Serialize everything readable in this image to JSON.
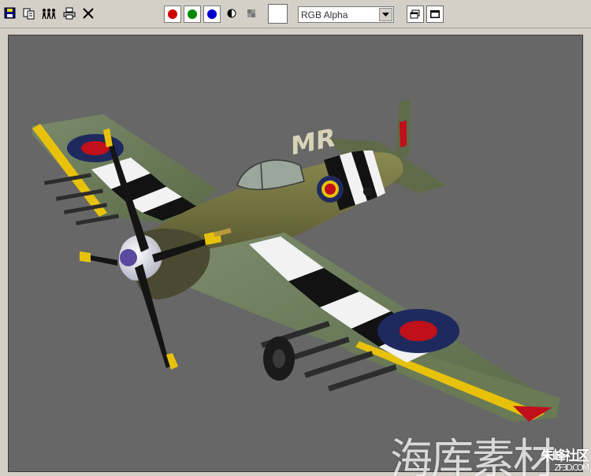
{
  "toolbar": {
    "tools": [
      {
        "name": "save-icon"
      },
      {
        "name": "clone-icon"
      },
      {
        "name": "users-icon"
      },
      {
        "name": "print-icon"
      },
      {
        "name": "clear-icon"
      }
    ],
    "channels": [
      {
        "name": "red-channel",
        "color": "#d00000"
      },
      {
        "name": "green-channel",
        "color": "#008800"
      },
      {
        "name": "blue-channel",
        "color": "#0000cc"
      }
    ],
    "swatch_color": "#ffffff",
    "channel_display": {
      "value": "RGB Alpha"
    }
  },
  "colors": {
    "viewport_bg": "#676767",
    "fuselage": "#6b6a3b",
    "stripe_black": "#121212",
    "stripe_white": "#f2f2f2",
    "roundel_blue": "#1e2a5e",
    "roundel_red": "#c0101a",
    "yellow": "#e8c20a",
    "spinner": "#5a4aa0"
  },
  "aircraft": {
    "code": "MR"
  },
  "watermark": {
    "text": "海库素材",
    "logo_cn": "朱峰社区",
    "logo_url": "ZF3D.COM"
  }
}
